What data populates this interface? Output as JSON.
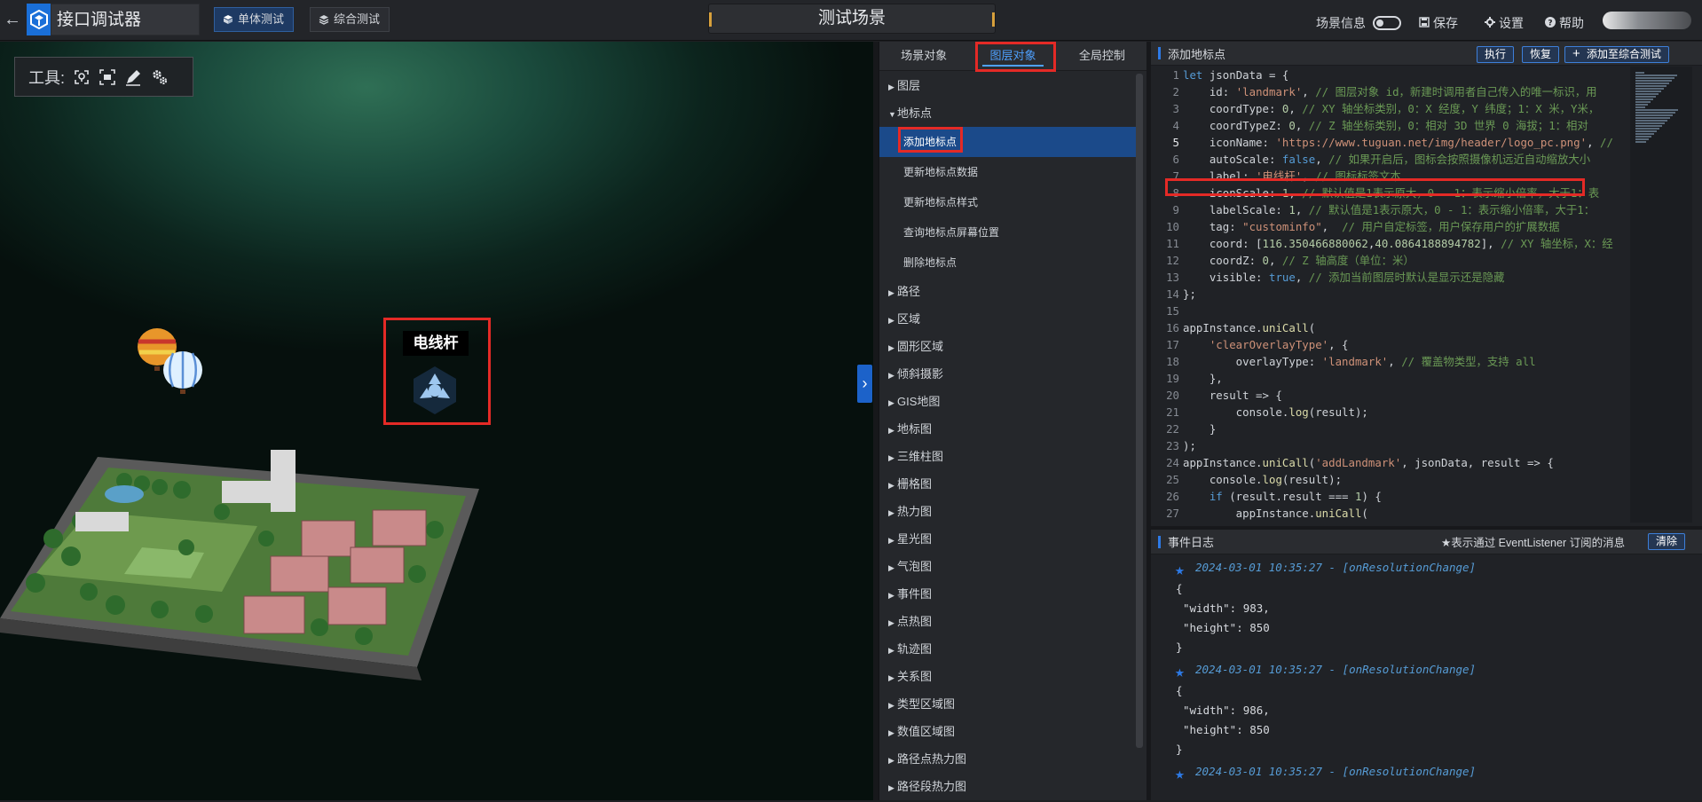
{
  "header": {
    "back_icon": "back-arrow-icon",
    "app_title": "接口调试器",
    "tabs": [
      "单体测试",
      "综合测试"
    ],
    "center_title": "测试场景",
    "scene_info_label": "场景信息",
    "save_label": "保存",
    "settings_label": "设置",
    "help_label": "帮助"
  },
  "viewport": {
    "tools_label": "工具:",
    "landmark_label": "电线杆"
  },
  "left_tabs": [
    "场景对象",
    "图层对象",
    "全局控制"
  ],
  "tree": [
    {
      "label": "图层",
      "expanded": false
    },
    {
      "label": "地标点",
      "expanded": true,
      "children": [
        "添加地标点",
        "更新地标点数据",
        "更新地标点样式",
        "查询地标点屏幕位置",
        "删除地标点"
      ]
    },
    {
      "label": "路径"
    },
    {
      "label": "区域"
    },
    {
      "label": "圆形区域"
    },
    {
      "label": "倾斜摄影"
    },
    {
      "label": "GIS地图"
    },
    {
      "label": "地标图"
    },
    {
      "label": "三维柱图"
    },
    {
      "label": "栅格图"
    },
    {
      "label": "热力图"
    },
    {
      "label": "星光图"
    },
    {
      "label": "气泡图"
    },
    {
      "label": "事件图"
    },
    {
      "label": "点热图"
    },
    {
      "label": "轨迹图"
    },
    {
      "label": "关系图"
    },
    {
      "label": "类型区域图"
    },
    {
      "label": "数值区域图"
    },
    {
      "label": "路径点热力图"
    },
    {
      "label": "路径段热力图"
    }
  ],
  "editor": {
    "title": "添加地标点",
    "run_label": "执行",
    "restore_label": "恢复",
    "add_label": "添加至综合测试",
    "current_line": 5
  },
  "log": {
    "title": "事件日志",
    "hint": "★表示通过 EventListener 订阅的消息",
    "clear_label": "清除",
    "entries": [
      {
        "time": "2024-03-01 10:35:27",
        "event": "onResolutionChange",
        "width": 983,
        "height": 850
      },
      {
        "time": "2024-03-01 10:35:27",
        "event": "onResolutionChange",
        "width": 986,
        "height": 850
      },
      {
        "time": "2024-03-01 10:35:27",
        "event": "onResolutionChange"
      }
    ]
  }
}
